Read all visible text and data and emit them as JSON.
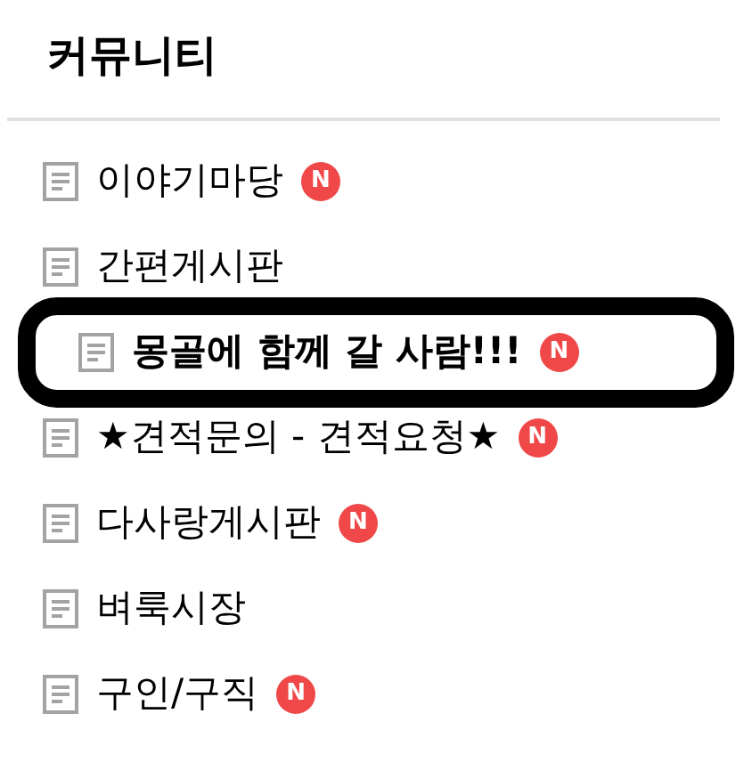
{
  "title": "커뮤니티",
  "items": [
    {
      "label": "이야기마당",
      "selected": false,
      "badge": "N"
    },
    {
      "label": "간편게시판",
      "selected": false
    },
    {
      "label": "몽골에 함께 갈 사람!!!",
      "selected": true,
      "badge": "N"
    },
    {
      "label": "★견적문의 - 견적요청★",
      "selected": false,
      "badge": "N"
    },
    {
      "label": "다사랑게시판",
      "selected": false,
      "badge": "N"
    },
    {
      "label": "벼룩시장",
      "selected": false
    },
    {
      "label": "구인/구직",
      "selected": false,
      "badge": "N"
    }
  ]
}
